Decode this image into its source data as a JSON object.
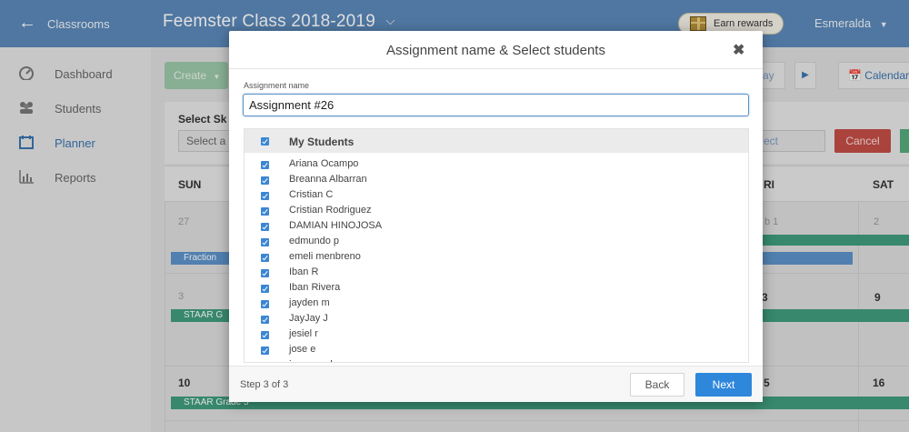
{
  "topbar": {
    "back_link": "Classrooms",
    "class_title": "Feemster Class 2018-2019",
    "earn_rewards": "Earn rewards",
    "user_name": "Esmeralda"
  },
  "sidebar": {
    "items": [
      {
        "label": "Dashboard",
        "icon": "dashboard-icon"
      },
      {
        "label": "Students",
        "icon": "students-icon"
      },
      {
        "label": "Planner",
        "icon": "calendar-icon",
        "active": true
      },
      {
        "label": "Reports",
        "icon": "reports-icon"
      }
    ]
  },
  "planner": {
    "create_label": "Create",
    "day_label": "ay",
    "calendar_label": "Calendar",
    "select_skills_label": "Select Sk",
    "select_placeholder": "Select a",
    "select_right": "ect",
    "cancel_label": "Cancel",
    "day_headers": [
      "SUN",
      "RI",
      "SAT"
    ],
    "dates": {
      "d27": "27",
      "d1": "b  1",
      "d2": "2",
      "d3": "3",
      "d8": "3",
      "d9": "9",
      "d10": "10",
      "d15": "5",
      "d16": "16"
    },
    "events": {
      "fraction": "Fraction",
      "staar1": "STAAR G",
      "staar2": "STAAR Grade 5"
    }
  },
  "modal": {
    "title": "Assignment name & Select students",
    "field_label": "Assignment name",
    "assignment_name": "Assignment #26",
    "list_header": "My Students",
    "students": [
      "Ariana Ocampo",
      "Breanna Albarran",
      "Cristian C",
      "Cristian Rodriguez",
      "DAMIAN HINOJOSA",
      "edmundo p",
      "emeli menbreno",
      "Iban R",
      "Iban Rivera",
      "jayden m",
      "JayJay J",
      "jesiel r",
      "jose e",
      "josue godoy"
    ],
    "step_text": "Step 3 of 3",
    "back_label": "Back",
    "next_label": "Next"
  },
  "colors": {
    "topbar": "#5a88b8",
    "accent": "#2f87dc",
    "cancel": "#c24d45",
    "event_green": "#3f9b7b",
    "event_blue": "#5d92c9"
  }
}
